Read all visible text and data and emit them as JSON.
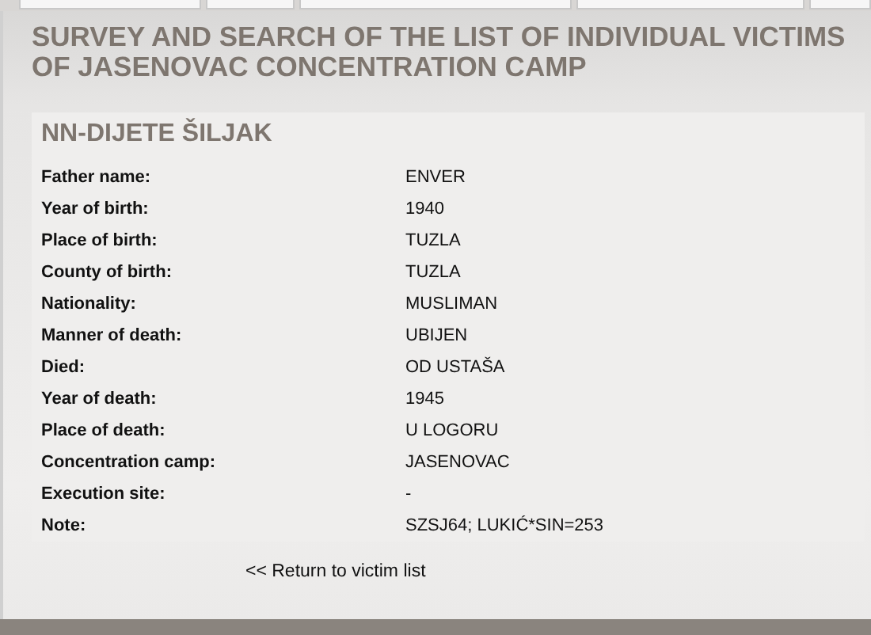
{
  "page_title": "SURVEY AND SEARCH OF THE LIST OF INDIVIDUAL VICTIMS OF JASENOVAC CONCENTRATION CAMP",
  "victim": {
    "name": "NN-DIJETE ŠILJAK",
    "fields": [
      {
        "label": "Father name:",
        "value": "ENVER"
      },
      {
        "label": "Year of birth:",
        "value": "1940"
      },
      {
        "label": "Place of birth:",
        "value": "TUZLA"
      },
      {
        "label": "County of birth:",
        "value": "TUZLA"
      },
      {
        "label": "Nationality:",
        "value": "MUSLIMAN"
      },
      {
        "label": "Manner of death:",
        "value": "UBIJEN"
      },
      {
        "label": "Died:",
        "value": "OD USTAŠA"
      },
      {
        "label": "Year of death:",
        "value": "1945"
      },
      {
        "label": "Place of death:",
        "value": "U LOGORU"
      },
      {
        "label": "Concentration camp:",
        "value": "JASENOVAC"
      },
      {
        "label": "Execution site:",
        "value": "-"
      },
      {
        "label": "Note:",
        "value": "SZSJ64; LUKIĆ*SIN=253"
      }
    ]
  },
  "return_link": "<< Return to victim list"
}
